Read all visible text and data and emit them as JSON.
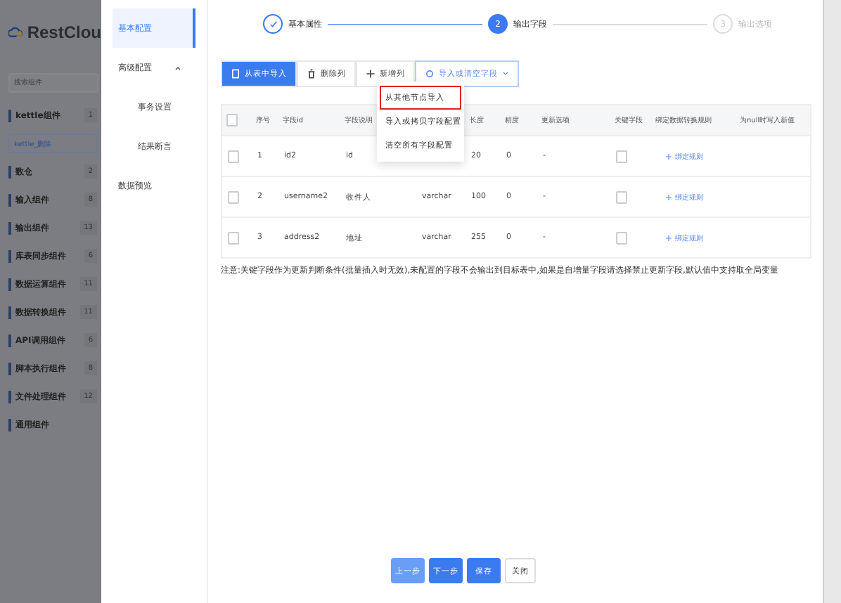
{
  "sidebar": {
    "logo": "RestClou",
    "search": {
      "placeholder": "搜索组件"
    },
    "groups": [
      {
        "label": "kettle组件",
        "count": "1",
        "children": [
          {
            "label": "kettle_删除"
          }
        ]
      },
      {
        "label": "数仓",
        "count": "2"
      },
      {
        "label": "输入组件",
        "count": "8"
      },
      {
        "label": "输出组件",
        "count": "13"
      },
      {
        "label": "库表同步组件",
        "count": "6"
      },
      {
        "label": "数据运算组件",
        "count": "11"
      },
      {
        "label": "数据转换组件",
        "count": "11"
      },
      {
        "label": "API调用组件",
        "count": "6"
      },
      {
        "label": "脚本执行组件",
        "count": "8"
      },
      {
        "label": "文件处理组件",
        "count": "12"
      },
      {
        "label": "通用组件"
      }
    ]
  },
  "drawer_menu": [
    {
      "label": "基本配置",
      "selected": true
    },
    {
      "label": "高级配置",
      "selected": false,
      "expanded": true,
      "children": [
        {
          "label": "事务设置",
          "selected": false
        },
        {
          "label": "结果断言",
          "selected": false
        }
      ]
    },
    {
      "label": "数据预览",
      "selected": false
    }
  ],
  "steps": [
    {
      "label": "基本属性",
      "done": true,
      "active": false
    },
    {
      "number": "2",
      "label": "输出字段",
      "done": false,
      "active": true
    },
    {
      "number": "3",
      "label": "输出选项",
      "done": false,
      "active": false
    }
  ],
  "toolbar": [
    {
      "label": "从表中导入",
      "kind": "primary"
    },
    {
      "label": "删除列",
      "kind": "delete"
    },
    {
      "label": "新增列",
      "kind": "add"
    },
    {
      "label": "导入或清空字段",
      "kind": "menu"
    }
  ],
  "dropdown": [
    {
      "label": "从其他节点导入",
      "highlighted": true
    },
    {
      "label": "导入或拷贝字段配置",
      "highlighted": false
    },
    {
      "label": "清空所有字段配置",
      "highlighted": false
    }
  ],
  "table": {
    "all_checked": false,
    "columns": [
      "序号",
      "字段id",
      "字段说明",
      null,
      "长度",
      "精度",
      "更新选项",
      "关键字段",
      "绑定数据转换规则",
      "为null时写入新值"
    ],
    "rows": [
      {
        "checked": false,
        "cells": [
          "1",
          "id2",
          "id",
          null,
          "20",
          "0",
          "-"
        ],
        "key": false,
        "rule": "绑定规则"
      },
      {
        "checked": false,
        "cells": [
          "2",
          "username2",
          "收件人",
          "varchar",
          "100",
          "0",
          "-"
        ],
        "key": false,
        "rule": "绑定规则"
      },
      {
        "checked": false,
        "cells": [
          "3",
          "address2",
          "地址",
          "varchar",
          "255",
          "0",
          "-"
        ],
        "key": false,
        "rule": "绑定规则"
      }
    ]
  },
  "note": "注意:关键字段作为更新判断条件(批量插入时无效),未配置的字段不会输出到目标表中,如果是自增量字段请选择禁止更新字段,默认值中支持取全局变量",
  "footer_buttons": [
    {
      "label": "上一步",
      "kind": "prev"
    },
    {
      "label": "下一步",
      "kind": "primary"
    },
    {
      "label": "保存",
      "kind": "primary"
    },
    {
      "label": "关闭",
      "kind": "plain"
    }
  ]
}
